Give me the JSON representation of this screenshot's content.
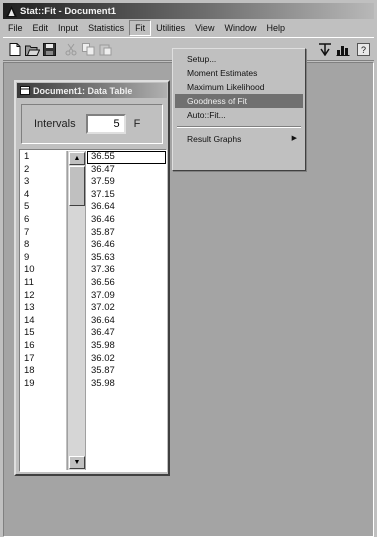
{
  "window": {
    "title": "Stat::Fit - Document1"
  },
  "menubar": {
    "items": [
      "File",
      "Edit",
      "Input",
      "Statistics",
      "Fit",
      "Utilities",
      "View",
      "Window",
      "Help"
    ],
    "active": "Fit"
  },
  "toolbar": {
    "icons": [
      "new-file-icon",
      "open-folder-icon",
      "save-disk-icon",
      "cut-icon",
      "copy-icon",
      "paste-icon",
      "histogram-icon",
      "chart-icon",
      "help-icon"
    ]
  },
  "fit_menu": {
    "items": [
      {
        "label": "Setup...",
        "highlighted": false
      },
      {
        "label": "Moment Estimates",
        "highlighted": false
      },
      {
        "label": "Maximum Likelihood",
        "highlighted": false
      },
      {
        "label": "Goodness of Fit",
        "highlighted": true
      },
      {
        "label": "Auto::Fit...",
        "highlighted": false
      },
      {
        "label": "Result Graphs",
        "highlighted": false,
        "has_submenu": true
      }
    ]
  },
  "document": {
    "title": "Document1: Data Table",
    "intervals_label": "Intervals",
    "intervals_value": "5",
    "next_label": "F",
    "rows": [
      {
        "index": "1",
        "value": "36.55"
      },
      {
        "index": "2",
        "value": "36.47"
      },
      {
        "index": "3",
        "value": "37.59"
      },
      {
        "index": "4",
        "value": "37.15"
      },
      {
        "index": "5",
        "value": "36.64"
      },
      {
        "index": "6",
        "value": "36.46"
      },
      {
        "index": "7",
        "value": "35.87"
      },
      {
        "index": "8",
        "value": "36.46"
      },
      {
        "index": "9",
        "value": "35.63"
      },
      {
        "index": "10",
        "value": "37.36"
      },
      {
        "index": "11",
        "value": "36.56"
      },
      {
        "index": "12",
        "value": "37.09"
      },
      {
        "index": "13",
        "value": "37.02"
      },
      {
        "index": "14",
        "value": "36.64"
      },
      {
        "index": "15",
        "value": "36.47"
      },
      {
        "index": "16",
        "value": "35.98"
      },
      {
        "index": "17",
        "value": "36.02"
      },
      {
        "index": "18",
        "value": "35.87"
      },
      {
        "index": "19",
        "value": "35.98"
      }
    ]
  }
}
